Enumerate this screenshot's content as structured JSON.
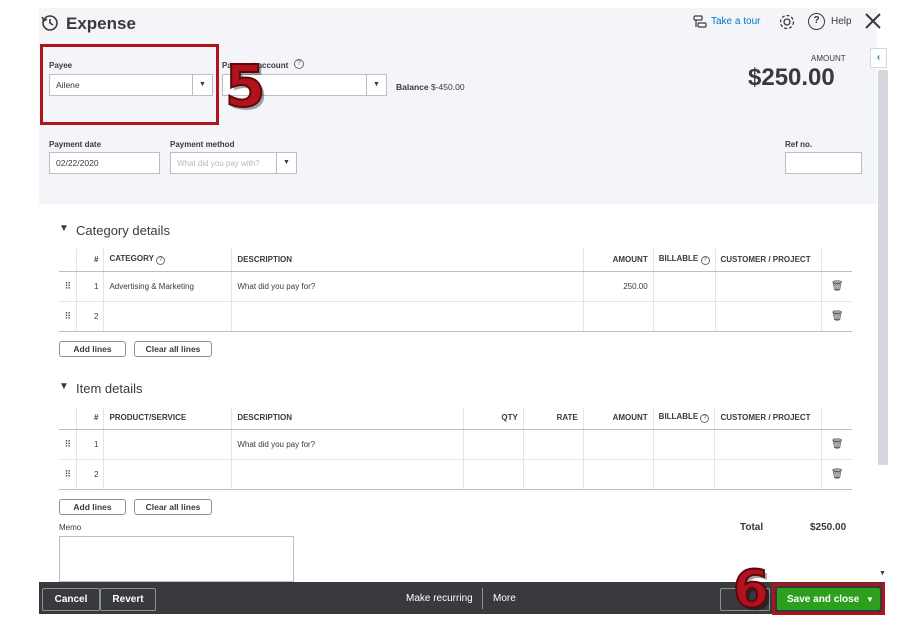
{
  "header": {
    "title": "Expense",
    "take_tour": "Take a tour",
    "help": "Help",
    "amount_label": "AMOUNT",
    "amount_value": "$250.00"
  },
  "form": {
    "payee_label": "Payee",
    "payee_value": "Ailene",
    "payment_account_label": "Payment account",
    "balance_label": "Balance",
    "balance_value": "$-450.00",
    "payment_date_label": "Payment date",
    "payment_date_value": "02/22/2020",
    "payment_method_label": "Payment method",
    "payment_method_placeholder": "What did you pay with?",
    "ref_label": "Ref no."
  },
  "category_details": {
    "title": "Category details",
    "headers": [
      "#",
      "CATEGORY",
      "DESCRIPTION",
      "AMOUNT",
      "BILLABLE",
      "CUSTOMER / PROJECT"
    ],
    "rows": [
      {
        "num": "1",
        "category": "Advertising & Marketing",
        "description_placeholder": "What did you pay for?",
        "amount": "250.00"
      },
      {
        "num": "2",
        "category": "",
        "description_placeholder": "",
        "amount": ""
      }
    ],
    "add_lines": "Add lines",
    "clear_lines": "Clear all lines"
  },
  "item_details": {
    "title": "Item details",
    "headers": [
      "#",
      "PRODUCT/SERVICE",
      "DESCRIPTION",
      "QTY",
      "RATE",
      "AMOUNT",
      "BILLABLE",
      "CUSTOMER / PROJECT"
    ],
    "rows": [
      {
        "num": "1",
        "description_placeholder": "What did you pay for?"
      },
      {
        "num": "2",
        "description_placeholder": ""
      }
    ],
    "add_lines": "Add lines",
    "clear_lines": "Clear all lines"
  },
  "memo_label": "Memo",
  "total_label": "Total",
  "total_value": "$250.00",
  "footer": {
    "cancel": "Cancel",
    "revert": "Revert",
    "make_recurring": "Make recurring",
    "more": "More",
    "save_close": "Save and close"
  },
  "annotations": {
    "step5": "5",
    "step6": "6"
  },
  "colors": {
    "accent_green": "#2ca01c",
    "annotation_red": "#b1121b",
    "link_blue": "#0077c5"
  }
}
